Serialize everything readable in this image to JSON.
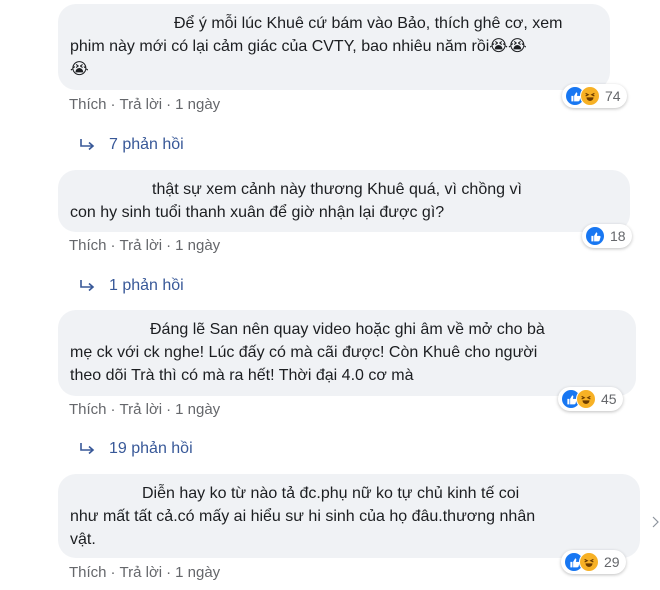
{
  "comments": [
    {
      "text": "Để ý mỗi lúc Khuê cứ bám vào Bảo, thích ghê cơ, xem phim này mới có lại cảm giác của CVTY, bao nhiêu năm rồi😭😭 😭",
      "line1": "Để ý mỗi lúc Khuê cứ bám vào Bảo, thích ghê cơ, xem",
      "line2": "phim này mới có lại cảm giác của CVTY, bao nhiêu năm rồi",
      "line2_emoji": "😭😭",
      "line3_emoji": "😭",
      "like_label": "Thích",
      "reply_label": "Trả lời",
      "time": "1 ngày",
      "reaction_count": "74",
      "reaction_icons": [
        "like-icon",
        "haha-icon"
      ],
      "replies_label": "7 phản hồi"
    },
    {
      "line1": "thật sự xem cảnh này thương Khuê quá, vì chồng vì",
      "line2": "con hy sinh tuổi thanh xuân để giờ nhận lại được gì?",
      "like_label": "Thích",
      "reply_label": "Trả lời",
      "time": "1 ngày",
      "reaction_count": "18",
      "reaction_icons": [
        "like-icon"
      ],
      "replies_label": "1 phản hồi"
    },
    {
      "line1": "Đáng lẽ San nên quay video hoặc ghi âm về mở cho bà",
      "line2": "mẹ ck với ck nghe! Lúc đấy có mà cãi được! Còn Khuê cho người",
      "line3": "theo dõi Trà thì có mà ra hết! Thời đại 4.0 cơ mà",
      "like_label": "Thích",
      "reply_label": "Trả lời",
      "time": "1 ngày",
      "reaction_count": "45",
      "reaction_icons": [
        "like-icon",
        "haha-icon"
      ],
      "replies_label": "19 phản hồi"
    },
    {
      "line1": "Diễn hay ko từ nào tả đc.phụ nữ ko tự chủ kinh tế coi",
      "line2": "như mất tất cả.có mấy ai hiểu sư hi sinh của họ đâu.thương nhân",
      "line3": "vật.",
      "like_label": "Thích",
      "reply_label": "Trả lời",
      "time": "1 ngày",
      "reaction_count": "29",
      "reaction_icons": [
        "like-icon",
        "haha-icon"
      ]
    }
  ],
  "separator": "·",
  "colors": {
    "bubble_bg": "#f0f2f5",
    "meta_text": "#65676b",
    "reply_link": "#385898",
    "like_blue": "#1877f2",
    "haha_yellow": "#f7b125"
  }
}
